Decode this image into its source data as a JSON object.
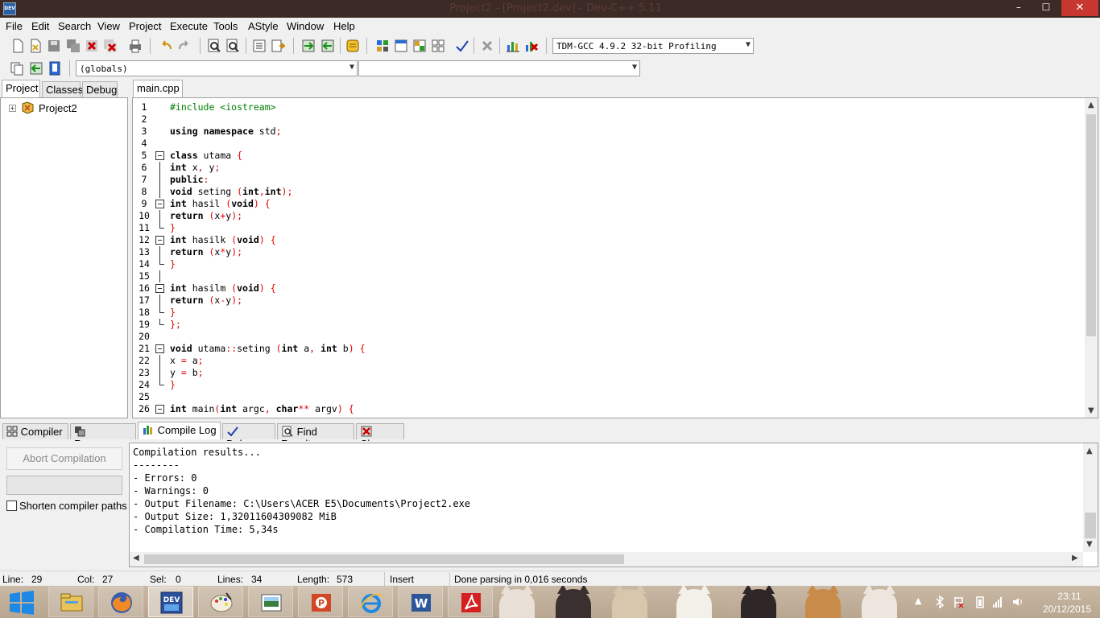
{
  "window": {
    "title": "Project2 - [Project2.dev] - Dev-C++ 5.11",
    "min": "–",
    "max": "☐",
    "close": "✕"
  },
  "menu": [
    "File",
    "Edit",
    "Search",
    "View",
    "Project",
    "Execute",
    "Tools",
    "AStyle",
    "Window",
    "Help"
  ],
  "compiler_select": "TDM-GCC 4.9.2 32-bit Profiling",
  "scope_select": "(globals)",
  "scope_select2": "",
  "left_tabs": [
    "Project",
    "Classes",
    "Debug"
  ],
  "project_tree": {
    "root": "Project2"
  },
  "editor_tab": "main.cpp",
  "code_lines": [
    {
      "n": "1",
      "t": "#include <iostream>"
    },
    {
      "n": "2",
      "t": ""
    },
    {
      "n": "3",
      "t": "using namespace std;"
    },
    {
      "n": "4",
      "t": ""
    },
    {
      "n": "5",
      "t": "class utama {"
    },
    {
      "n": "6",
      "t": "int x, y;"
    },
    {
      "n": "7",
      "t": "public:"
    },
    {
      "n": "8",
      "t": "void seting (int,int);"
    },
    {
      "n": "9",
      "t": "int hasil (void) {"
    },
    {
      "n": "10",
      "t": "return (x+y);"
    },
    {
      "n": "11",
      "t": "}"
    },
    {
      "n": "12",
      "t": "int hasilk (void) {"
    },
    {
      "n": "13",
      "t": "return (x*y);"
    },
    {
      "n": "14",
      "t": "}"
    },
    {
      "n": "15",
      "t": ""
    },
    {
      "n": "16",
      "t": "int hasilm (void) {"
    },
    {
      "n": "17",
      "t": "return (x-y);"
    },
    {
      "n": "18",
      "t": "}"
    },
    {
      "n": "19",
      "t": "};"
    },
    {
      "n": "20",
      "t": ""
    },
    {
      "n": "21",
      "t": "void utama::seting (int a, int b) {"
    },
    {
      "n": "22",
      "t": "x = a;"
    },
    {
      "n": "23",
      "t": "y = b;"
    },
    {
      "n": "24",
      "t": "}"
    },
    {
      "n": "25",
      "t": ""
    },
    {
      "n": "26",
      "t": "int main(int argc, char** argv) {"
    }
  ],
  "bottom_tabs": [
    "Compiler",
    "Resources",
    "Compile Log",
    "Debug",
    "Find Results",
    "Close"
  ],
  "abort_button": "Abort Compilation",
  "shorten_paths": "Shorten compiler paths",
  "log_lines": [
    "Compilation results...",
    "--------",
    "- Errors: 0",
    "- Warnings: 0",
    "- Output Filename: C:\\Users\\ACER E5\\Documents\\Project2.exe",
    "- Output Size: 1,32011604309082 MiB",
    "- Compilation Time: 5,34s"
  ],
  "status": {
    "line_label": "Line:",
    "line": "29",
    "col_label": "Col:",
    "col": "27",
    "sel_label": "Sel:",
    "sel": "0",
    "lines_label": "Lines:",
    "lines": "34",
    "length_label": "Length:",
    "length": "573",
    "mode": "Insert",
    "message": "Done parsing in 0,016 seconds"
  },
  "clock": {
    "time": "23:11",
    "date": "20/12/2015"
  },
  "taskbar_apps": [
    "file-explorer",
    "firefox",
    "dev-cpp",
    "paint",
    "photo-viewer",
    "powerpoint",
    "internet-explorer",
    "word",
    "acrobat"
  ],
  "dev_icon_text": "DEV",
  "colors": {
    "keyword": "#000000",
    "symbol": "#e00000",
    "titlebar": "#3c2a26",
    "close": "#c7372f"
  }
}
